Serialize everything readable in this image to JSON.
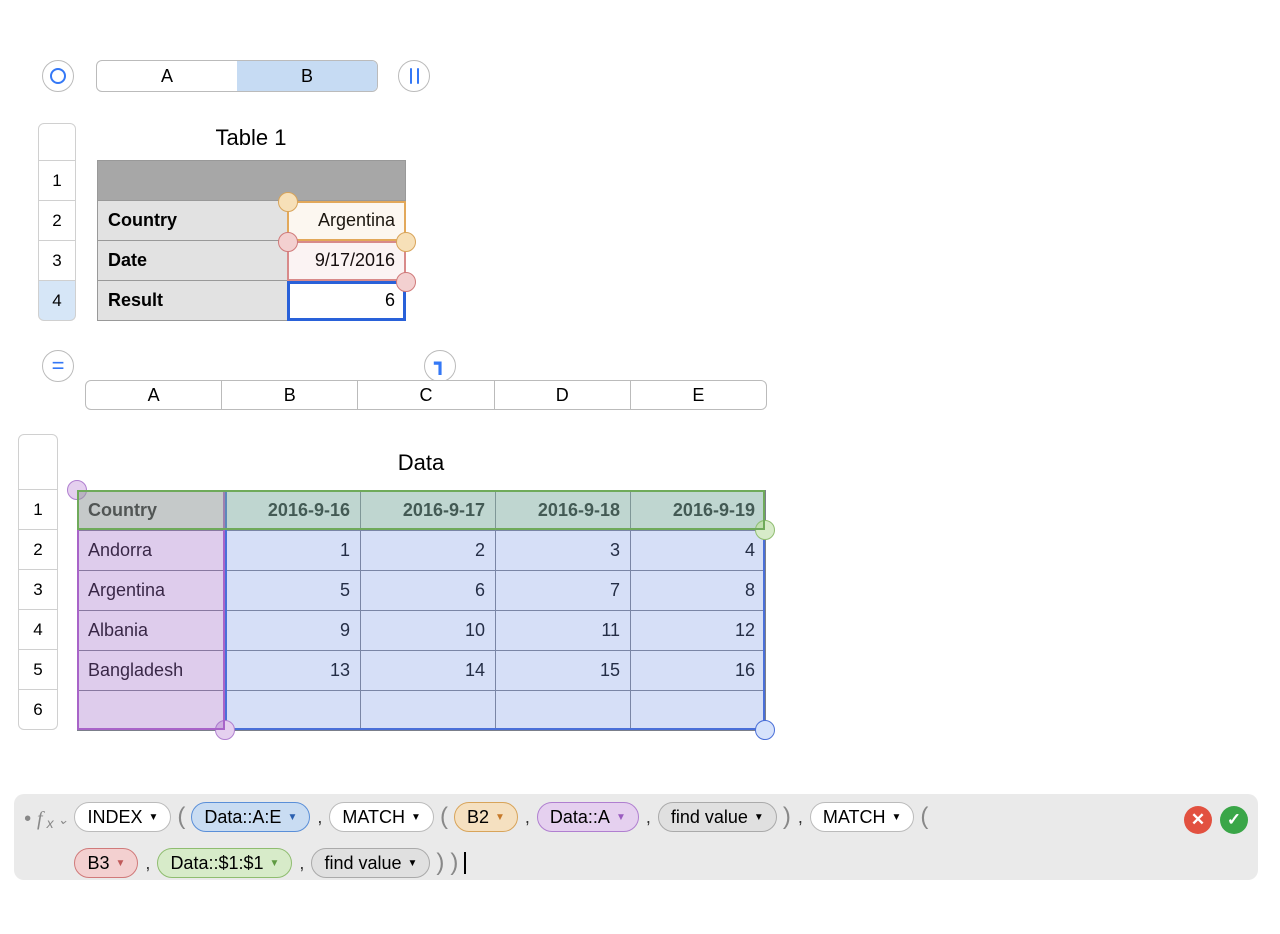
{
  "top": {
    "colA": "A",
    "colB": "B"
  },
  "table1": {
    "title": "Table 1",
    "rowNums": [
      "1",
      "2",
      "3",
      "4"
    ],
    "labels": {
      "country": "Country",
      "date": "Date",
      "result": "Result"
    },
    "values": {
      "country": "Argentina",
      "date": "9/17/2016",
      "result": "6"
    }
  },
  "midCols": [
    "A",
    "B",
    "C",
    "D",
    "E"
  ],
  "data": {
    "title": "Data",
    "rowNums": [
      "1",
      "2",
      "3",
      "4",
      "5",
      "6"
    ],
    "headers": [
      "Country",
      "2016-9-16",
      "2016-9-17",
      "2016-9-18",
      "2016-9-19"
    ],
    "rows": [
      {
        "country": "Andorra",
        "v": [
          "1",
          "2",
          "3",
          "4"
        ]
      },
      {
        "country": "Argentina",
        "v": [
          "5",
          "6",
          "7",
          "8"
        ]
      },
      {
        "country": "Albania",
        "v": [
          "9",
          "10",
          "11",
          "12"
        ]
      },
      {
        "country": "Bangladesh",
        "v": [
          "13",
          "14",
          "15",
          "16"
        ]
      }
    ]
  },
  "fx": {
    "label": "x",
    "index": "INDEX",
    "dataAE": "Data::A:E",
    "match": "MATCH",
    "b2": "B2",
    "dataA": "Data::A",
    "findValue": "find value",
    "match2": "MATCH",
    "b3": "B3",
    "data11": "Data::$1:$1",
    "findValue2": "find value"
  }
}
